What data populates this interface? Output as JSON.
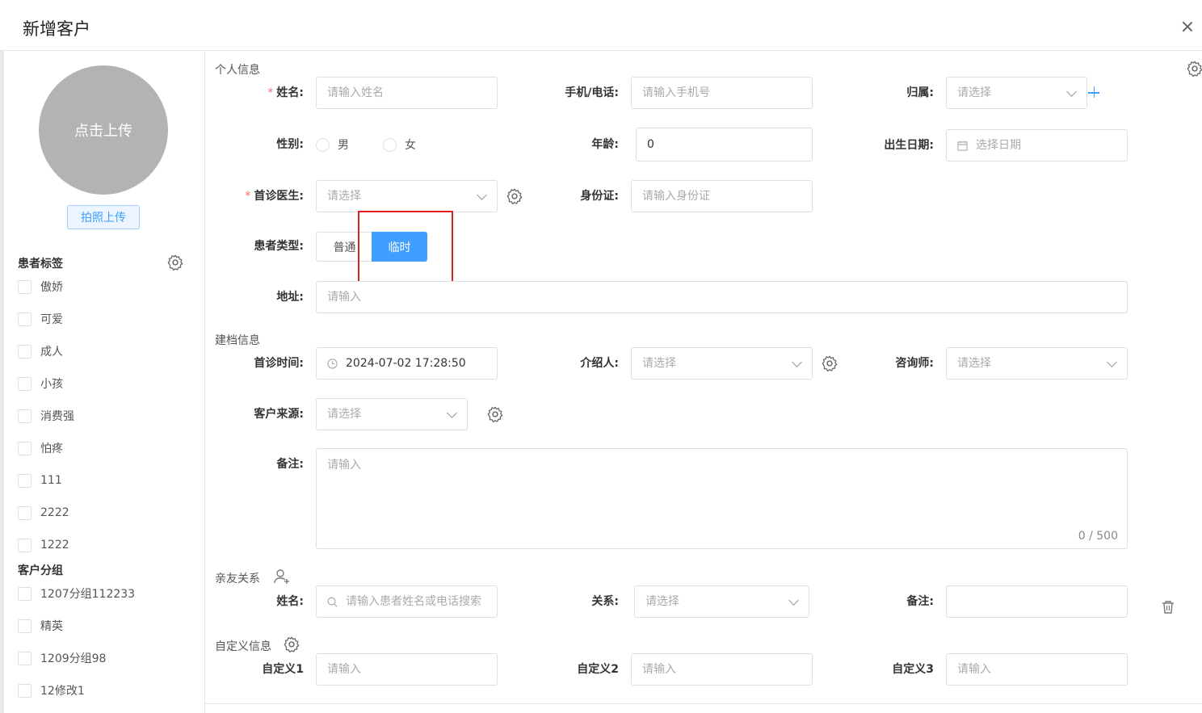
{
  "dialog": {
    "title": "新增客户"
  },
  "avatar": {
    "upload_label": "点击上传",
    "photo_button": "拍照上传"
  },
  "patient_tags": {
    "title": "患者标签",
    "items": [
      "傲娇",
      "可爱",
      "成人",
      "小孩",
      "消费强",
      "怕疼",
      "111",
      "2222",
      "1222"
    ]
  },
  "customer_groups": {
    "title": "客户分组",
    "items": [
      "1207分组112233",
      "精英",
      "1209分组98",
      "12修改1"
    ]
  },
  "personal": {
    "section_title": "个人信息",
    "name": {
      "required": "*",
      "label": "姓名:",
      "placeholder": "请输入姓名"
    },
    "phone": {
      "label": "手机/电话:",
      "placeholder": "请输入手机号"
    },
    "belong": {
      "label": "归属:",
      "placeholder": "请选择"
    },
    "gender": {
      "label": "性别:",
      "options": [
        "男",
        "女"
      ]
    },
    "age": {
      "label": "年龄:",
      "value": "0"
    },
    "birthdate": {
      "label": "出生日期:",
      "placeholder": "选择日期"
    },
    "doctor": {
      "required": "*",
      "label": "首诊医生:",
      "placeholder": "请选择"
    },
    "id_card": {
      "label": "身份证:",
      "placeholder": "请输入身份证"
    },
    "patient_type": {
      "label": "患者类型:",
      "options": [
        "普通",
        "临时"
      ],
      "selected": "临时"
    },
    "address": {
      "label": "地址:",
      "placeholder": "请输入"
    }
  },
  "archive": {
    "section_title": "建档信息",
    "first_visit": {
      "label": "首诊时间:",
      "value": "2024-07-02 17:28:50"
    },
    "referrer": {
      "label": "介绍人:",
      "placeholder": "请选择"
    },
    "consultant": {
      "label": "咨询师:",
      "placeholder": "请选择"
    },
    "source": {
      "label": "客户来源:",
      "placeholder": "请选择"
    },
    "remark": {
      "label": "备注:",
      "placeholder": "请输入",
      "counter": "0 / 500"
    }
  },
  "relatives": {
    "section_title": "亲友关系",
    "name": {
      "label": "姓名:",
      "placeholder": "请输入患者姓名或电话搜索"
    },
    "relation": {
      "label": "关系:",
      "placeholder": "请选择"
    },
    "remark": {
      "label": "备注:",
      "placeholder": ""
    }
  },
  "custom": {
    "section_title": "自定义信息",
    "fields": [
      {
        "label": "自定义1",
        "placeholder": "请输入"
      },
      {
        "label": "自定义2",
        "placeholder": "请输入"
      },
      {
        "label": "自定义3",
        "placeholder": "请输入"
      }
    ]
  },
  "colors": {
    "primary": "#409eff",
    "required": "#f56c6c",
    "highlight_box": "#e02020",
    "avatar_bg": "#b3b3b3"
  }
}
